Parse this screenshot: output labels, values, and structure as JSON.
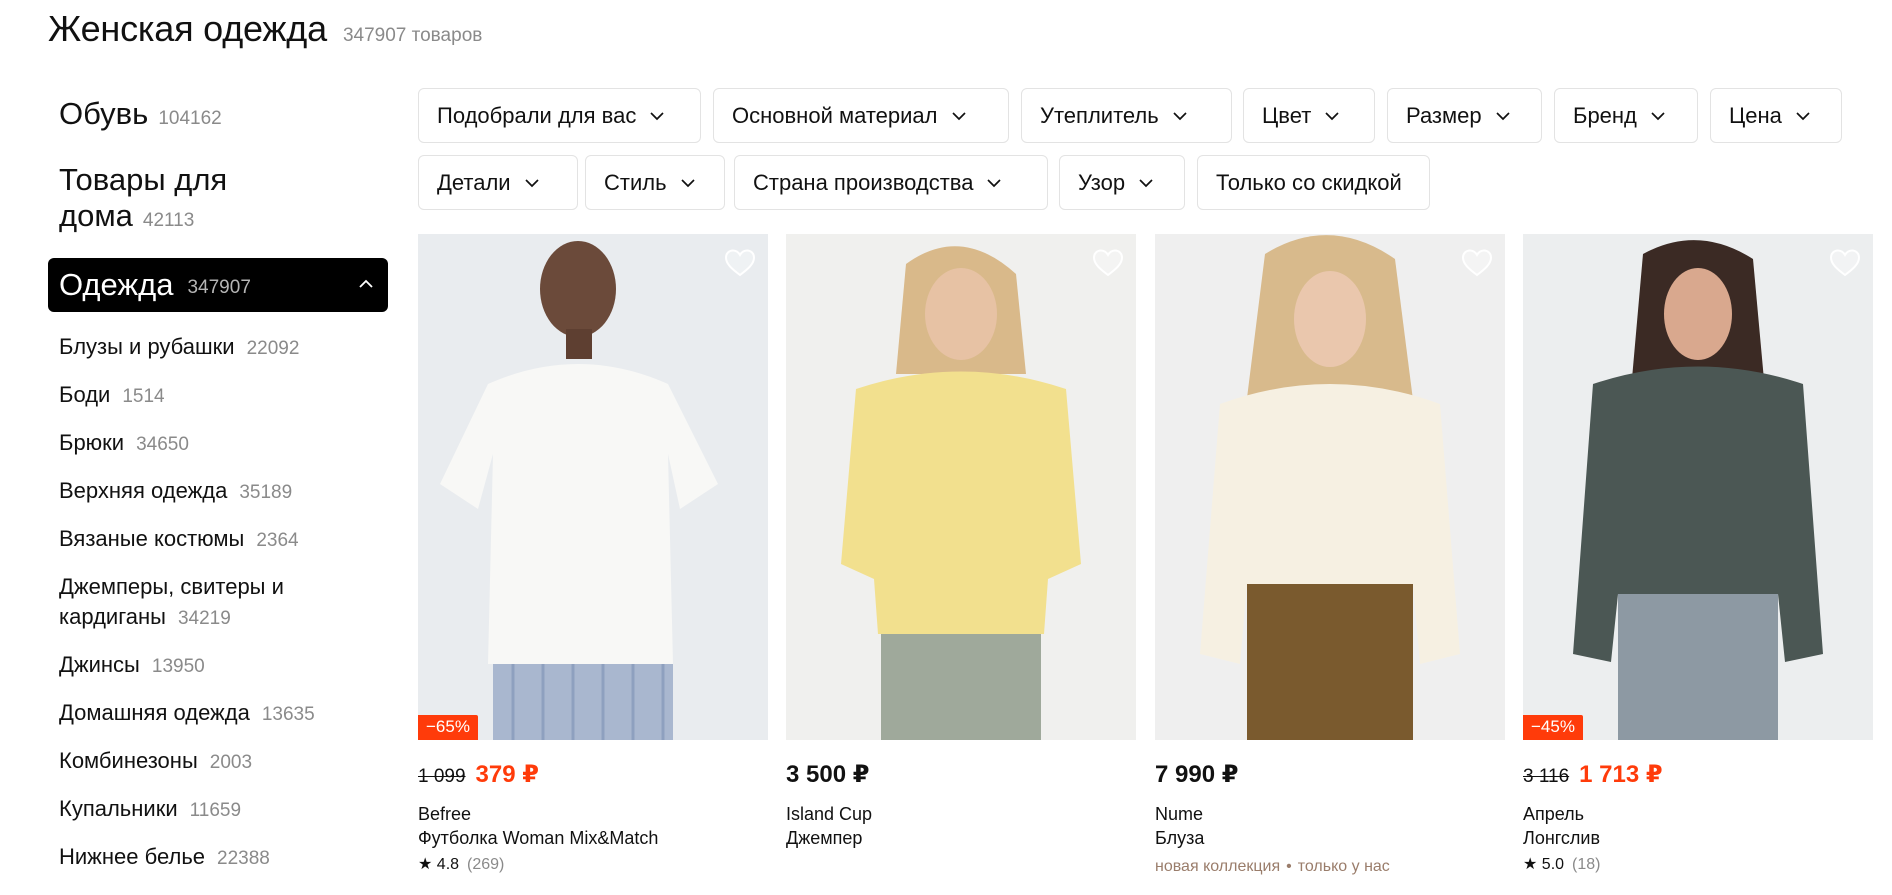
{
  "header": {
    "title": "Женская одежда",
    "count": "347907 товаров"
  },
  "sidebar": {
    "top": [
      {
        "label": "Обувь",
        "count": "104162"
      },
      {
        "label": "Товары для дома",
        "count": "42113"
      }
    ],
    "active": {
      "label": "Одежда",
      "count": "347907"
    },
    "subcategories": [
      {
        "label": "Блузы и рубашки",
        "count": "22092"
      },
      {
        "label": "Боди",
        "count": "1514"
      },
      {
        "label": "Брюки",
        "count": "34650"
      },
      {
        "label": "Верхняя одежда",
        "count": "35189"
      },
      {
        "label": "Вязаные костюмы",
        "count": "2364"
      },
      {
        "label": "Джемперы, свитеры и кардиганы",
        "count": "34219"
      },
      {
        "label": "Джинсы",
        "count": "13950"
      },
      {
        "label": "Домашняя одежда",
        "count": "13635"
      },
      {
        "label": "Комбинезоны",
        "count": "2003"
      },
      {
        "label": "Купальники",
        "count": "11659"
      },
      {
        "label": "Нижнее белье",
        "count": "22388"
      }
    ]
  },
  "filters": [
    "Подобрали для вас",
    "Основной материал",
    "Утеплитель",
    "Цвет",
    "Размер",
    "Бренд",
    "Цена",
    "Детали",
    "Стиль",
    "Страна производства",
    "Узор",
    "Только со скидкой"
  ],
  "products": [
    {
      "discount": "−65%",
      "old_price": "1 099",
      "price": "379 ₽",
      "brand": "Befree",
      "name": "Футболка Woman Mix&Match",
      "rating": "★ 4.8",
      "reviews": "(269)"
    },
    {
      "price": "3 500 ₽",
      "brand": "Island Cup",
      "name": "Джемпер"
    },
    {
      "price": "7 990 ₽",
      "brand": "Nume",
      "name": "Блуза",
      "tag1": "новая коллекция",
      "tag_sep": "•",
      "tag2": "только у нас"
    },
    {
      "discount": "−45%",
      "old_price": "3 116",
      "price": "1 713 ₽",
      "brand": "Апрель",
      "name": "Лонгслив",
      "rating": "★ 5.0",
      "reviews": "(18)"
    }
  ],
  "colors": {
    "accent": "#ff3b0a",
    "active_bg": "#000000",
    "muted": "#8a8a8a"
  },
  "icons": {
    "filter_chevron": "chevron-down-icon",
    "favorite": "heart-icon",
    "collapse": "chevron-up-icon"
  }
}
